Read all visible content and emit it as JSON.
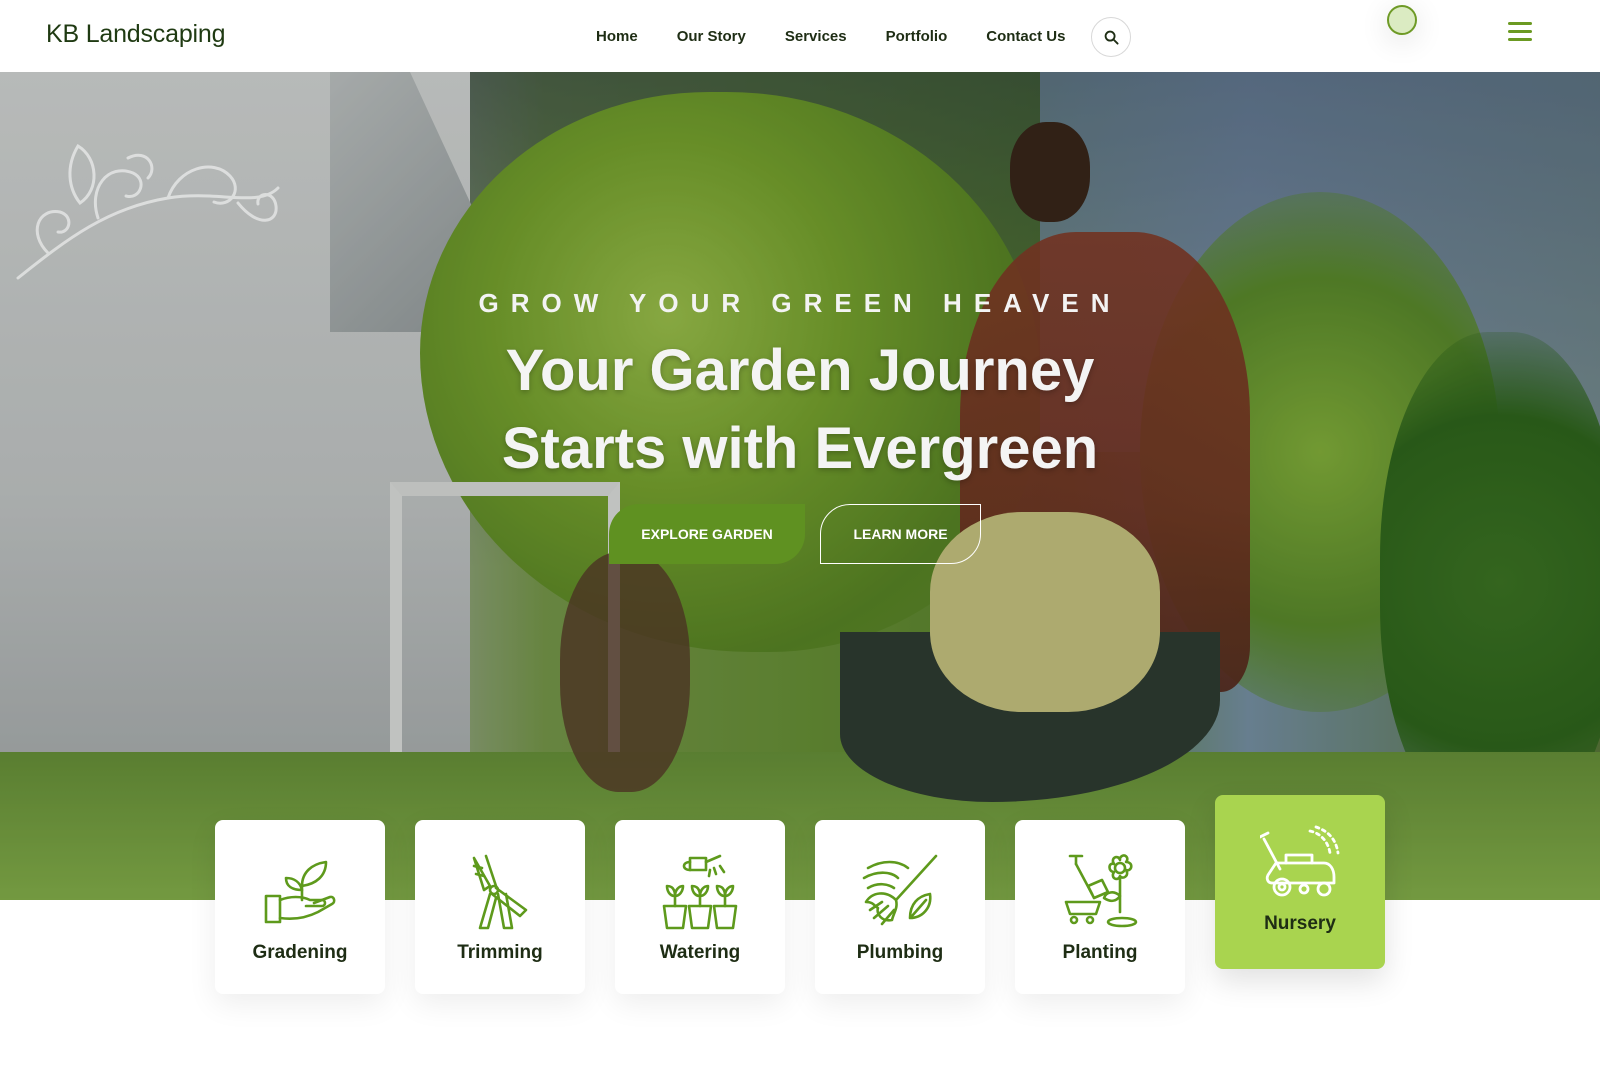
{
  "header": {
    "logo": "KB Landscaping",
    "nav": [
      "Home",
      "Our Story",
      "Services",
      "Portfolio",
      "Contact Us"
    ],
    "accent_color": "#6b9a22"
  },
  "hero": {
    "tagline": "GROW YOUR GREEN HEAVEN",
    "title_line1": "Your Garden Journey",
    "title_line2": "Starts with Evergreen",
    "primary_button": "EXPLORE GARDEN",
    "secondary_button": "LEARN MORE",
    "primary_color": "#5f9121"
  },
  "services": [
    {
      "label": "Gradening",
      "icon": "gardening-hand-plant-icon"
    },
    {
      "label": "Trimming",
      "icon": "pruning-shears-icon"
    },
    {
      "label": "Watering",
      "icon": "watering-can-pots-icon"
    },
    {
      "label": "Plumbing",
      "icon": "rake-leaf-icon"
    },
    {
      "label": "Planting",
      "icon": "shovel-flower-icon"
    },
    {
      "label": "Nursery",
      "icon": "lawn-mower-icon",
      "active": true
    }
  ],
  "active_card_color": "#a9d44f"
}
